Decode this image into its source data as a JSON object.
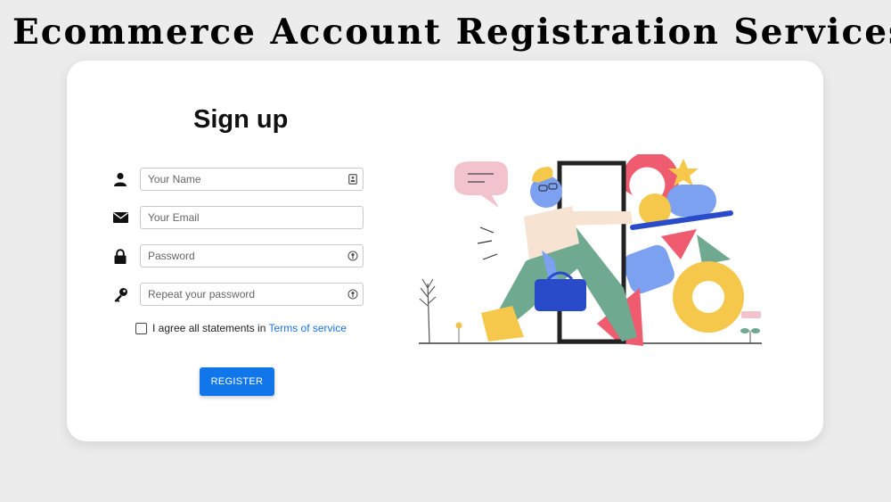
{
  "banner": {
    "text": "Ecommerce Account Registration Services"
  },
  "form": {
    "title": "Sign up",
    "fields": [
      {
        "icon": "user-icon",
        "placeholder": "Your Name",
        "value": "",
        "trailing_icon": "contact-card-icon"
      },
      {
        "icon": "envelope-icon",
        "placeholder": "Your Email",
        "value": ""
      },
      {
        "icon": "lock-icon",
        "placeholder": "Password",
        "value": "",
        "trailing_icon": "key-autofill-icon"
      },
      {
        "icon": "key-icon",
        "placeholder": "Repeat your password",
        "value": "",
        "trailing_icon": "key-autofill-icon"
      }
    ],
    "agree": {
      "text": "I agree all statements in ",
      "link_text": "Terms of service",
      "checked": false
    },
    "register_label": "REGISTER"
  },
  "colors": {
    "accent": "#1176ea",
    "link": "#1a73e8"
  },
  "illustration": {
    "icon": "person-walking-through-door-illustration"
  }
}
